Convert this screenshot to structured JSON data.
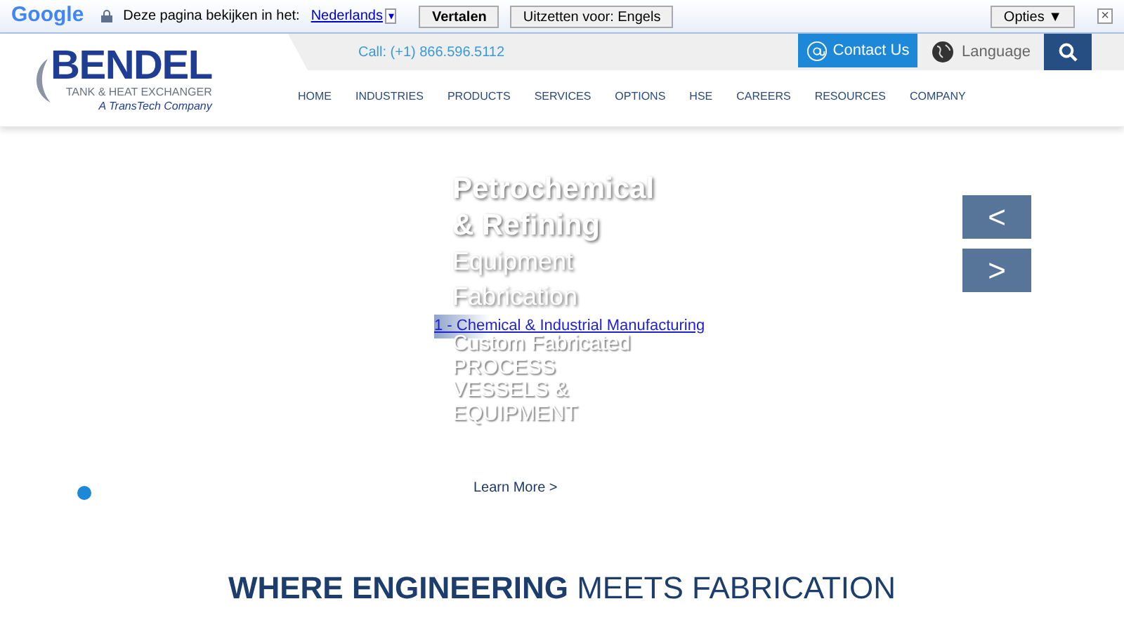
{
  "translate_bar": {
    "google_logo": "Google",
    "prompt": "Deze pagina bekijken in het:",
    "language": "Nederlands",
    "dropdown": "▾",
    "translate_button": "Vertalen",
    "turn_off_button": "Uitzetten voor: Engels",
    "options_button": "Opties ▼",
    "close": "×"
  },
  "header": {
    "logo": {
      "name": "BENDEL",
      "tagline": "TANK & HEAT EXCHANGER",
      "subtitle": "A TransTech Company"
    },
    "phone": "Call: (+1) 866.596.5112",
    "contact_button": "Contact Us",
    "language": "Language",
    "nav": [
      {
        "label": "HOME"
      },
      {
        "label": "INDUSTRIES"
      },
      {
        "label": "PRODUCTS"
      },
      {
        "label": "SERVICES"
      },
      {
        "label": "OPTIONS"
      },
      {
        "label": "HSE"
      },
      {
        "label": "CAREERS"
      },
      {
        "label": "RESOURCES"
      },
      {
        "label": "COMPANY"
      }
    ]
  },
  "hero": {
    "title_lines": [
      "Petrochemical",
      "& Refining"
    ],
    "subtitle_lines": [
      "Equipment",
      "Fabrication"
    ],
    "link": "1 - Chemical & Industrial Manufacturing",
    "body_lines": [
      "Custom Fabricated",
      "PROCESS",
      "VESSELS &",
      "EQUIPMENT"
    ],
    "learn_more": "Learn More >",
    "prev": "<",
    "next": ">",
    "slide_dots": [
      {
        "selected": true
      }
    ]
  },
  "section_heading": "**WHERE ENGINEERING** MEETS FABRICATION"
}
